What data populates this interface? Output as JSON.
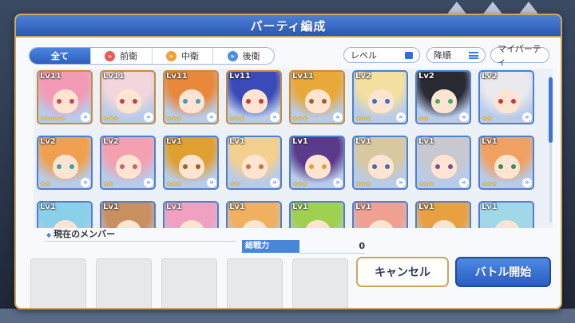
{
  "dialog": {
    "title": "パーティ編成"
  },
  "tabs": [
    {
      "label": "全て",
      "icon": "none"
    },
    {
      "label": "前衛",
      "icon": "front-role-icon",
      "color": "#e85a5a"
    },
    {
      "label": "中衛",
      "icon": "middle-role-icon",
      "color": "#f0a030"
    },
    {
      "label": "後衛",
      "icon": "back-role-icon",
      "color": "#4a90e2"
    }
  ],
  "controls": {
    "sort_label": "レベル",
    "order_label": "降順",
    "my_party_label": "マイパーティ"
  },
  "cards_row1": [
    {
      "lv": "Lv11",
      "stars": "★★★★★",
      "frame": "gold",
      "hair": "#f39bb5",
      "eye": "#d0406a"
    },
    {
      "lv": "Lv11",
      "stars": "★★★",
      "frame": "gold",
      "hair": "#f3d6dc",
      "eye": "#c0405a"
    },
    {
      "lv": "Lv11",
      "stars": "★★★",
      "frame": "gold",
      "hair": "#e8883a",
      "eye": "#3aa0c8"
    },
    {
      "lv": "Lv11",
      "stars": "★★★",
      "frame": "gold",
      "hair": "#3a4ab8",
      "eye": "#c83a3a"
    },
    {
      "lv": "Lv11",
      "stars": "★★★",
      "frame": "gold",
      "hair": "#e8a83a",
      "eye": "#a0602a"
    },
    {
      "lv": "Lv2",
      "stars": "★★★",
      "frame": "blue",
      "hair": "#f3e0a0",
      "eye": "#3a70c8"
    },
    {
      "lv": "Lv2",
      "stars": "★★",
      "frame": "blue",
      "hair": "#2a2a35",
      "eye": "#3ab06a"
    },
    {
      "lv": "Lv2",
      "stars": "★★",
      "frame": "blue",
      "hair": "#eaeaee",
      "eye": "#c03a50"
    }
  ],
  "cards_row2": [
    {
      "lv": "Lv2",
      "stars": "★★",
      "frame": "blue",
      "hair": "#f0a050",
      "eye": "#3aa0a0"
    },
    {
      "lv": "Lv2",
      "stars": "★★",
      "frame": "blue",
      "hair": "#f3a0b0",
      "eye": "#d05a7a"
    },
    {
      "lv": "Lv1",
      "stars": "★★★",
      "frame": "blue",
      "hair": "#e0a030",
      "eye": "#a06020"
    },
    {
      "lv": "Lv1",
      "stars": "★★",
      "frame": "blue",
      "hair": "#f3d090",
      "eye": "#d07030"
    },
    {
      "lv": "Lv1",
      "stars": "★★★",
      "frame": "blue",
      "hair": "#5a3a8a",
      "eye": "#e0a030"
    },
    {
      "lv": "Lv1",
      "stars": "★★★",
      "frame": "blue",
      "hair": "#d8c8a0",
      "eye": "#4a6ab0"
    },
    {
      "lv": "Lv1",
      "stars": "★★★",
      "frame": "blue",
      "hair": "#c8c8d0",
      "eye": "#7a4aa0"
    },
    {
      "lv": "Lv1",
      "stars": "★★★",
      "frame": "blue",
      "hair": "#f0a060",
      "eye": "#3a8a5a"
    }
  ],
  "cards_row3": [
    {
      "lv": "Lv1",
      "hair": "#8ad0e8"
    },
    {
      "lv": "Lv1",
      "hair": "#c89060"
    },
    {
      "lv": "Lv1",
      "hair": "#f0a0c0"
    },
    {
      "lv": "Lv1",
      "hair": "#f0b060"
    },
    {
      "lv": "Lv1",
      "hair": "#a0d050"
    },
    {
      "lv": "Lv1",
      "hair": "#f0a090"
    },
    {
      "lv": "Lv1",
      "hair": "#e8a040"
    },
    {
      "lv": "Lv1",
      "hair": "#a0d8e8"
    }
  ],
  "members": {
    "label": "現在のメンバー",
    "power_label": "総戦力",
    "power_value": "0"
  },
  "buttons": {
    "cancel": "キャンセル",
    "start": "バトル開始"
  }
}
